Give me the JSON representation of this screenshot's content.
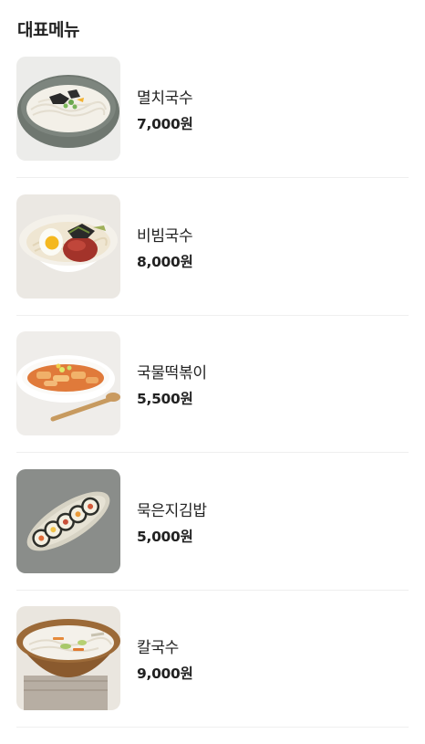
{
  "section": {
    "title": "대표메뉴"
  },
  "menu": {
    "items": [
      {
        "name": "멸치국수",
        "price": "7,000원",
        "image": "anchovy-noodle-bowl-image"
      },
      {
        "name": "비빔국수",
        "price": "8,000원",
        "image": "spicy-mixed-noodle-bowl-image"
      },
      {
        "name": "국물떡볶이",
        "price": "5,500원",
        "image": "soup-tteokbokki-plate-image"
      },
      {
        "name": "묵은지김밥",
        "price": "5,000원",
        "image": "kimchi-gimbap-plate-image"
      },
      {
        "name": "칼국수",
        "price": "9,000원",
        "image": "kalguksu-bowl-image"
      }
    ]
  }
}
